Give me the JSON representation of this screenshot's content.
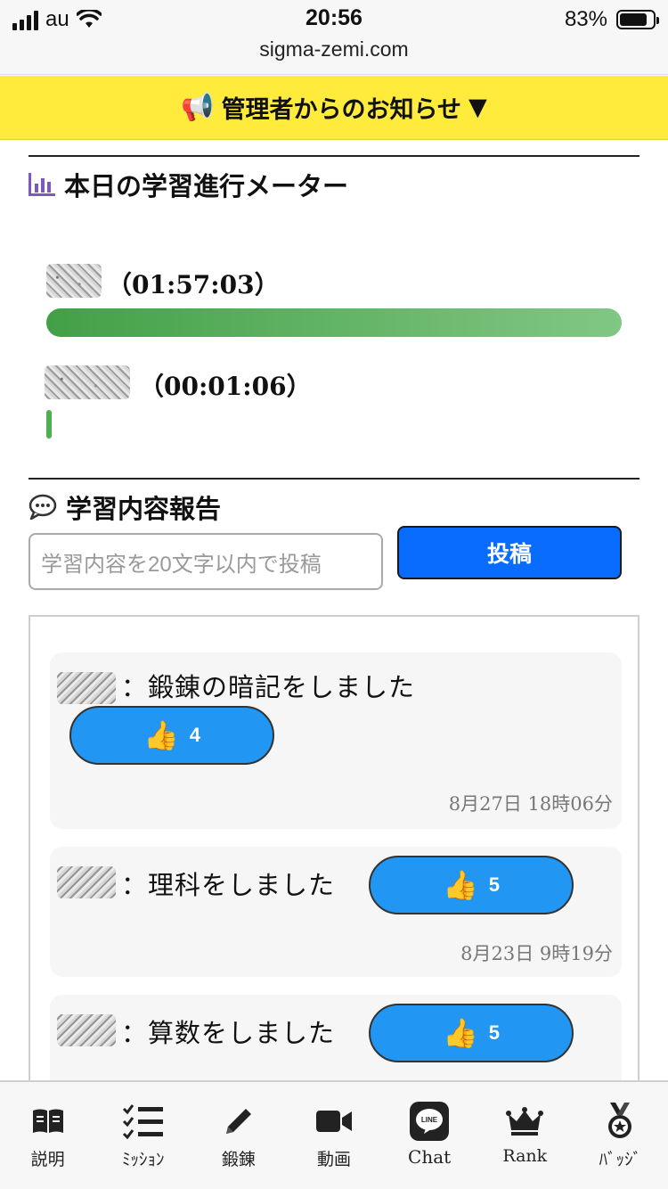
{
  "status_bar": {
    "carrier": "au",
    "time": "20:56",
    "url": "sigma-zemi.com",
    "battery": "83%",
    "battery_level": 0.83
  },
  "announcement": {
    "icon": "megaphone-icon",
    "label": "管理者からのお知らせ",
    "arrow": "▼",
    "color": "#ffeb3b"
  },
  "meter": {
    "title": "本日の学習進行メーター",
    "title_icon": "bar-chart-icon",
    "rows": [
      {
        "time": "（01:57:03）",
        "progress": 1.0
      },
      {
        "time": "（00:01:06）",
        "progress": 0.009
      }
    ]
  },
  "report": {
    "title": "学習内容報告",
    "title_icon": "chat-bubble-icon",
    "placeholder": "学習内容を20文字以内で投稿",
    "post_label": "投稿",
    "accent": "#0a6cff"
  },
  "feed": [
    {
      "sep": "：",
      "text": "鍛錬の暗記をしました",
      "likes": "4",
      "date": "8月27日 18時06分"
    },
    {
      "sep": "：",
      "text": "理科をしました",
      "likes": "5",
      "date": "8月23日 9時19分"
    },
    {
      "sep": "：",
      "text": "算数をしました",
      "likes": "5",
      "date": ""
    }
  ],
  "nav": [
    {
      "icon": "book-icon",
      "label": "説明"
    },
    {
      "icon": "checklist-icon",
      "label": "ﾐｯｼｮﾝ"
    },
    {
      "icon": "pencil-icon",
      "label": "鍛錬"
    },
    {
      "icon": "video-camera-icon",
      "label": "動画"
    },
    {
      "icon": "line-chat-icon",
      "label": "Chat"
    },
    {
      "icon": "crown-icon",
      "label": "Rank"
    },
    {
      "icon": "medal-icon",
      "label": "ﾊﾞｯｼﾞ"
    }
  ]
}
